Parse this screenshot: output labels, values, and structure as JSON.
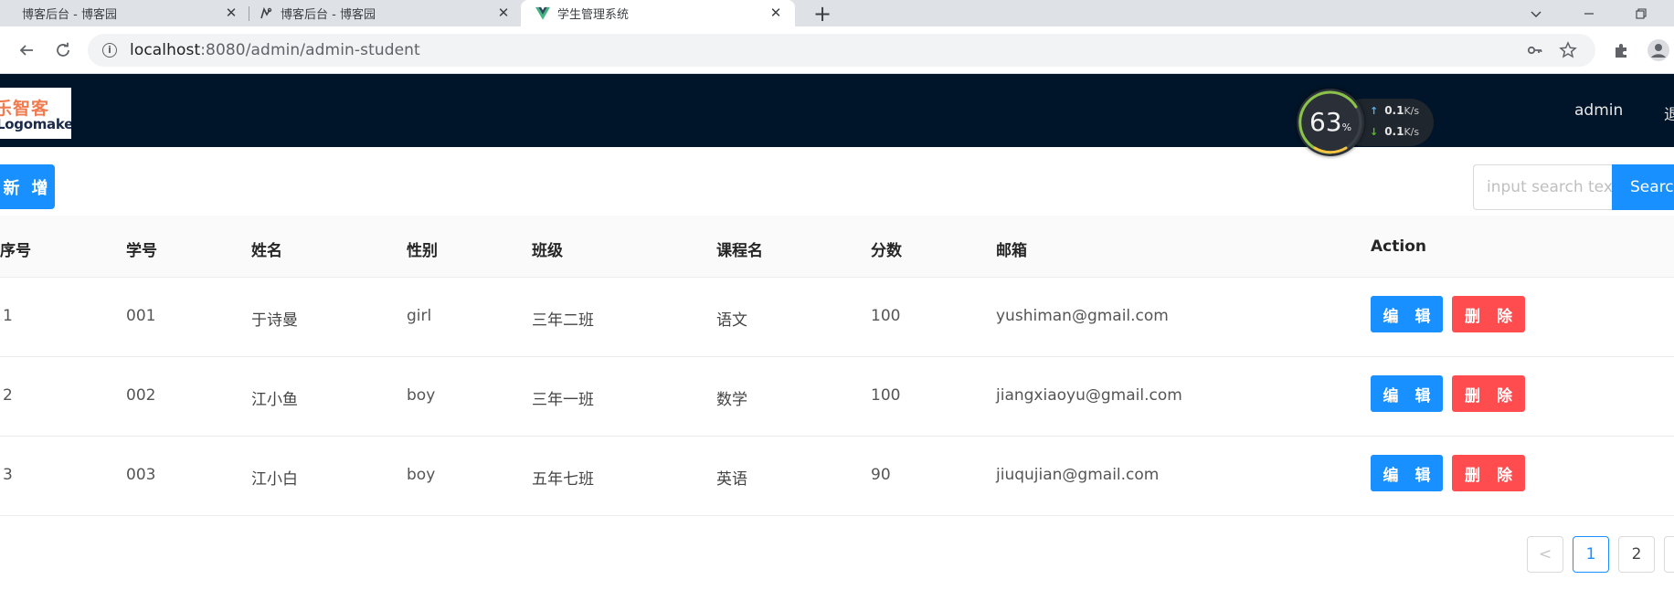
{
  "browser": {
    "tabs": [
      {
        "title": "博客后台 - 博客园"
      },
      {
        "title": "博客后台 - 博客园"
      },
      {
        "title": "学生管理系统"
      }
    ],
    "new_tab": "+",
    "close_glyph": "✕",
    "url_host": "localhost",
    "url_path": ":8080/admin/admin-student"
  },
  "header": {
    "logo_cn": "乐智客",
    "logo_en": "Logomaker",
    "user": "admin",
    "logout": "退出"
  },
  "speed_widget": {
    "percent": "63",
    "percent_unit": "%",
    "up_value": "0.1",
    "down_value": "0.1",
    "unit": "K/s"
  },
  "toolbar": {
    "add_label": "新 增",
    "search_placeholder": "input search text",
    "search_label": "Search"
  },
  "table": {
    "columns": [
      "序号",
      "学号",
      "姓名",
      "性别",
      "班级",
      "课程名",
      "分数",
      "邮箱",
      "Action"
    ],
    "rows": [
      [
        "1",
        "001",
        "于诗曼",
        "girl",
        "三年二班",
        "语文",
        "100",
        "yushiman@gmail.com"
      ],
      [
        "2",
        "002",
        "江小鱼",
        "boy",
        "三年一班",
        "数学",
        "100",
        "jiangxiaoyu@gmail.com"
      ],
      [
        "3",
        "003",
        "江小白",
        "boy",
        "五年七班",
        "英语",
        "90",
        "jiuqujian@gmail.com"
      ]
    ],
    "edit_label": "编 辑",
    "delete_label": "删 除"
  },
  "pagination": {
    "prev": "<",
    "pages": [
      "1",
      "2"
    ]
  },
  "colors": {
    "primary": "#1890ff",
    "danger": "#ff4d4f",
    "header_bg": "#001529"
  }
}
